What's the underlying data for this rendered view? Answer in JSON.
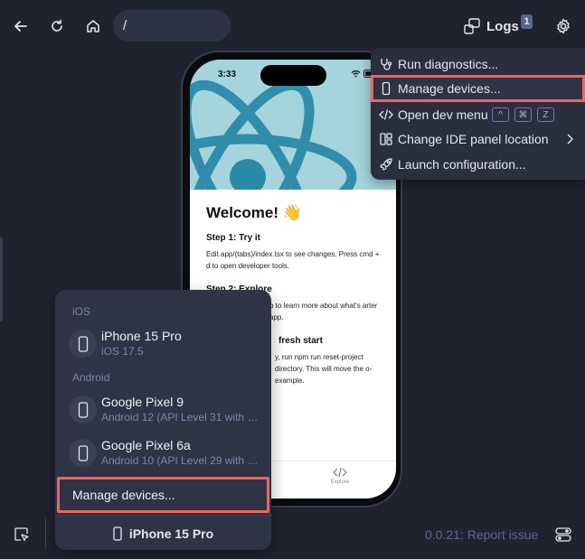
{
  "toolbar": {
    "url": "/",
    "logs_label": "Logs",
    "logs_count": "1"
  },
  "settings_menu": {
    "items": [
      {
        "label": "Run diagnostics...",
        "icon": "stethoscope-icon"
      },
      {
        "label": "Manage devices...",
        "icon": "device-icon"
      },
      {
        "label": "Open dev menu",
        "icon": "code-icon",
        "shortcut": [
          "^",
          "⌘",
          "Z"
        ]
      },
      {
        "label": "Change IDE panel location",
        "icon": "panel-layout-icon"
      },
      {
        "label": "Launch configuration...",
        "icon": "rocket-icon"
      }
    ]
  },
  "phone": {
    "time": "3:33",
    "welcome": "Welcome! 👋",
    "step1_title": "Step 1: Try it",
    "step1_body": "Edit app/(tabs)/index.tsx to see changes. Press cmd + d to open developer tools.",
    "step2_title": "Step 2: Explore",
    "step2_body": "b to learn more about what's arter app.",
    "step3_title": "fresh start",
    "step3_body": "y, run npm run reset-project directory. This will move the o-example.",
    "explore_tab": "Explore"
  },
  "device_popover": {
    "ios_section": "iOS",
    "android_section": "Android",
    "devices": [
      {
        "name": "iPhone 15 Pro",
        "sub": "iOS 17.5"
      },
      {
        "name": "Google Pixel 9",
        "sub": "Android 12 (API Level 31 with …"
      },
      {
        "name": "Google Pixel 6a",
        "sub": "Android 10 (API Level 29 with …"
      }
    ],
    "manage_label": "Manage devices..."
  },
  "bottom": {
    "selected_device": "iPhone 15 Pro",
    "version": "0.0.21: Report issue"
  },
  "colors": {
    "background": "#1f2330",
    "highlight": "#f0645f",
    "muted_text": "#7c86a8"
  }
}
